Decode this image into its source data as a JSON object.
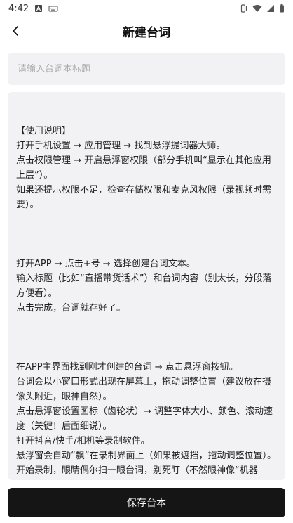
{
  "status_bar": {
    "time": "4:42"
  },
  "header": {
    "title": "新建台词"
  },
  "title_input": {
    "placeholder": "请输入台词本标题",
    "value": ""
  },
  "content": {
    "lines": [
      "",
      "【使用说明】",
      "打开手机设置 → 应用管理 → 找到悬浮提词器大师。",
      "点击权限管理 → 开启悬浮窗权限（部分手机叫“显示在其他应用上层”）。",
      "如果还提示权限不足，检查存储权限和麦克风权限（录视频时需要）。",
      "",
      "",
      "",
      "打开APP → 点击+号 → 选择创建台词文本。",
      "输入标题（比如“直播带货话术”）和台词内容（别太长，分段落方便看）。",
      "点击完成，台词就存好了。",
      "",
      "",
      "",
      "在APP主界面找到刚才创建的台词 → 点击悬浮窗按钮。",
      "台词会以小窗口形式出现在屏幕上，拖动调整位置（建议放在摄像头附近，眼神自然）。",
      "点击悬浮窗设置图标（齿轮状）→ 调整字体大小、颜色、滚动速度（关键！后面细说）。",
      "打开抖音/快手/相机等录制软件。",
      "悬浮窗会自动“飘”在录制界面上（如果被遮挡，拖动调整位置）。",
      "开始录制，眼睛偶尔扫一眼台词，别死盯（不然眼神像“机器人”）。"
    ]
  },
  "save_button": {
    "label": "保存台本"
  }
}
